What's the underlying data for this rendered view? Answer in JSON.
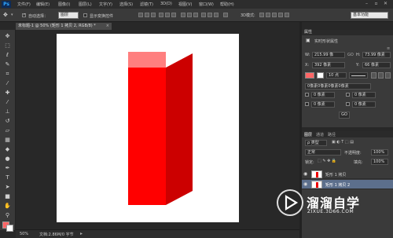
{
  "app": {
    "logo": "Ps"
  },
  "menubar": {
    "items": [
      "文件(F)",
      "编辑(E)",
      "图像(I)",
      "图层(L)",
      "文字(Y)",
      "选择(S)",
      "滤镜(T)",
      "3D(D)",
      "视图(V)",
      "窗口(W)",
      "帮助(H)"
    ],
    "window_buttons": [
      "–",
      "▫",
      "✕"
    ]
  },
  "options": {
    "auto_select_label": "自动选择：",
    "auto_select_value": "图层",
    "transform_label": "显示变换控件",
    "workspace": "基本功能"
  },
  "document_tab": {
    "title": "未标题-1 @ 50% (矩形 1 拷贝 2, RGB/8) *",
    "close": "×"
  },
  "status": {
    "zoom": "50%",
    "doc_info": "文档:2.86M/0 字节"
  },
  "properties": {
    "tabs": [
      "属性"
    ],
    "title": "实时形状属性",
    "w_label": "W:",
    "w_value": "215.99 像",
    "link_label": "GO",
    "h_label": "H:",
    "h_value": "73.99 像素",
    "x_label": "X:",
    "x_value": "392 像素",
    "y_label": "Y:",
    "y_value": "66 像素",
    "stroke_value": "10 点",
    "corner_text": "0像素0像素0像素0像素",
    "corner_a": "0 像素",
    "corner_b": "0 像素",
    "corner_c": "0 像素",
    "corner_d": "0 像素",
    "go_label": "GO"
  },
  "layers": {
    "tabs": [
      "图层",
      "通道",
      "路径"
    ],
    "kind_label": "ρ 类型",
    "blend_mode": "正常",
    "opacity_label": "不透明度:",
    "opacity_value": "100%",
    "lock_label": "锁定:",
    "fill_label": "填充:",
    "fill_value": "100%",
    "rows": [
      {
        "name": "矩形 1 拷贝"
      },
      {
        "name": "矩形 1 拷贝 2"
      }
    ]
  },
  "watermark": {
    "brand": "溜溜自学",
    "url": "ZIXUE.3D66.COM"
  },
  "colors": {
    "front_face": "#ff0000",
    "side_face": "#cc0000",
    "top_highlight": "#ff7f7f",
    "foreground_swatch": "#ff6666",
    "background_swatch": "#ffffff"
  }
}
